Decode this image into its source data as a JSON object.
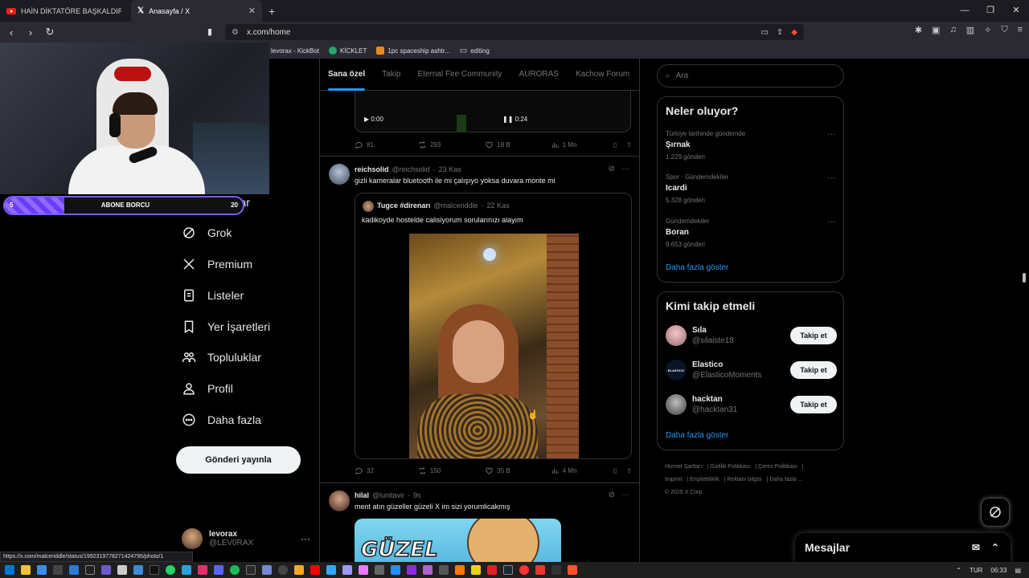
{
  "browser": {
    "tabs": [
      {
        "title": "HAİN DİKTATÖRE BAŞKALDIRI ! | 2025",
        "icon": "youtube-icon"
      },
      {
        "title": "Anasayfa / X",
        "icon": "x-logo-icon"
      }
    ],
    "url": "x.com/home",
    "bookmarks": [
      "levorax - KickBot",
      "KİCKLET",
      "1pc spaceship ashtr...",
      "editing"
    ],
    "status_url": "https://x.com/malceriddle/status/1992319778271424795/photo/1"
  },
  "overlay": {
    "sub_label": "ABONE BORCU",
    "sub_current": "5",
    "sub_goal": "20",
    "sub_progress": 0.25
  },
  "sidebar": {
    "items": [
      {
        "label": "Mesajlar",
        "icon": "mail-icon"
      },
      {
        "label": "Grok",
        "icon": "grok-icon"
      },
      {
        "label": "Premium",
        "icon": "x-logo-icon"
      },
      {
        "label": "Listeler",
        "icon": "list-icon"
      },
      {
        "label": "Yer İşaretleri",
        "icon": "bookmark-icon"
      },
      {
        "label": "Topluluklar",
        "icon": "communities-icon"
      },
      {
        "label": "Profil",
        "icon": "profile-icon"
      },
      {
        "label": "Daha fazla",
        "icon": "more-circle-icon"
      }
    ],
    "post_button": "Gönderi yayınla",
    "account": {
      "name": "levorax",
      "handle": "@LEV0RAX"
    }
  },
  "feed": {
    "tabs": [
      "Sana özel",
      "Takip",
      "Eternal Fire Community",
      "AURORAS",
      "Kachow Forum"
    ],
    "video": {
      "current": "0:00",
      "remaining": "0:24"
    },
    "post0_stats": {
      "replies": "81",
      "reposts": "293",
      "likes": "18 B",
      "views": "1 Mn"
    },
    "post1": {
      "name": "reichsolid",
      "handle": "@reichsolid",
      "time": "23 Kas",
      "text": "gizli kameralar bluetooth ile mi çalışıyo yoksa duvara monte mi",
      "quote": {
        "name": "Tugce #direnarı",
        "handle": "@malceriddle",
        "time": "22 Kas",
        "text": "kadikoyde hostelde calisiyorum sorularınızı alayım"
      },
      "stats": {
        "replies": "32",
        "reposts": "150",
        "likes": "35 B",
        "views": "4 Mn"
      }
    },
    "post2": {
      "name": "hilal",
      "handle": "@lunitavir",
      "time": "9s",
      "text": "ment atın güzeller güzeli X im sizi yorumlicakmış",
      "media_text": "GÜZEL"
    }
  },
  "right": {
    "search_placeholder": "Ara",
    "trends_title": "Neler oluyor?",
    "trends": [
      {
        "context": "Türkiye tarihinde gündemde",
        "name": "Şırnak",
        "count": "1.229 gönderi"
      },
      {
        "context": "Spor · Gündemdekiler",
        "name": "Icardi",
        "count": "5.328 gönderi"
      },
      {
        "context": "Gündemdekiler",
        "name": "Boran",
        "count": "9.653 gönderi"
      }
    ],
    "show_more": "Daha fazla göster",
    "who_title": "Kimi takip etmeli",
    "who": [
      {
        "name": "Sıla",
        "handle": "@silaiste18"
      },
      {
        "name": "Elastico",
        "handle": "@ElasticoMoments"
      },
      {
        "name": "hacktan",
        "handle": "@hacktan31"
      }
    ],
    "follow_label": "Takip et",
    "footer": [
      "Hizmet Şartları",
      "Gizlilik Politikası",
      "Çerez Politikası",
      "Imprint",
      "Erişilebilirlik",
      "Reklam bilgisi",
      "Daha fazla ...",
      "© 2025 X Corp."
    ]
  },
  "messages_drawer": "Mesajlar",
  "taskbar": {
    "lang": "TUR",
    "time": "06:33"
  }
}
